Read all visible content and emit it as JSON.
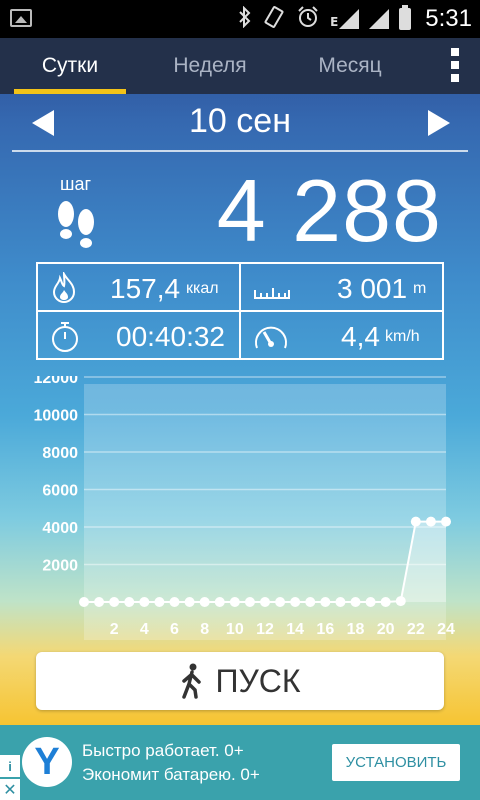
{
  "status_bar": {
    "time": "5:31",
    "icons": [
      "image-icon",
      "bluetooth-icon",
      "vibrate-icon",
      "alarm-icon",
      "signal-e-icon",
      "signal-icon",
      "battery-icon"
    ],
    "network_type": "E"
  },
  "tabs": [
    {
      "label": "Сутки",
      "active": true
    },
    {
      "label": "Неделя",
      "active": false
    },
    {
      "label": "Месяц",
      "active": false
    }
  ],
  "date": {
    "label": "10 сен"
  },
  "steps": {
    "label": "шаг",
    "value": "4 288"
  },
  "stats": {
    "calories": {
      "value": "157,4",
      "unit": "ккал"
    },
    "distance": {
      "value": "3 001",
      "unit": "m"
    },
    "duration": {
      "value": "00:40:32"
    },
    "speed": {
      "value": "4,4",
      "unit": "km/h"
    }
  },
  "chart_data": {
    "type": "area",
    "yticks": [
      "12000",
      "10000",
      "8000",
      "6000",
      "4000",
      "2000"
    ],
    "ytick_values": [
      12000,
      10000,
      8000,
      6000,
      4000,
      2000
    ],
    "xticks": [
      "2",
      "4",
      "6",
      "8",
      "10",
      "12",
      "14",
      "16",
      "18",
      "20",
      "22",
      "24"
    ],
    "ylim": [
      0,
      12000
    ],
    "x": [
      0,
      1,
      2,
      3,
      4,
      5,
      6,
      7,
      8,
      9,
      10,
      11,
      12,
      13,
      14,
      15,
      16,
      17,
      18,
      19,
      20,
      21,
      22,
      23,
      24
    ],
    "values": [
      0,
      0,
      0,
      0,
      0,
      0,
      0,
      0,
      0,
      0,
      0,
      0,
      0,
      0,
      0,
      0,
      0,
      0,
      0,
      0,
      0,
      50,
      4288,
      4288,
      4288
    ],
    "grid": true,
    "colors": {
      "line": "#ffffff",
      "point": "#ffffff",
      "fill": "#ffffff"
    }
  },
  "start_button": {
    "label": "ПУСК"
  },
  "ad": {
    "logo_letter": "Y",
    "line1": "Быстро работает. 0+",
    "line2": "Экономит батарею. 0+",
    "install_label": "УСТАНОВИТЬ",
    "info_label": "i",
    "close_label": "✕",
    "colors": {
      "background": "#3aa2ac",
      "button_text": "#2e8fa2"
    }
  },
  "colors": {
    "tab_bar": "#23304a",
    "tab_indicator": "#f3c318"
  }
}
